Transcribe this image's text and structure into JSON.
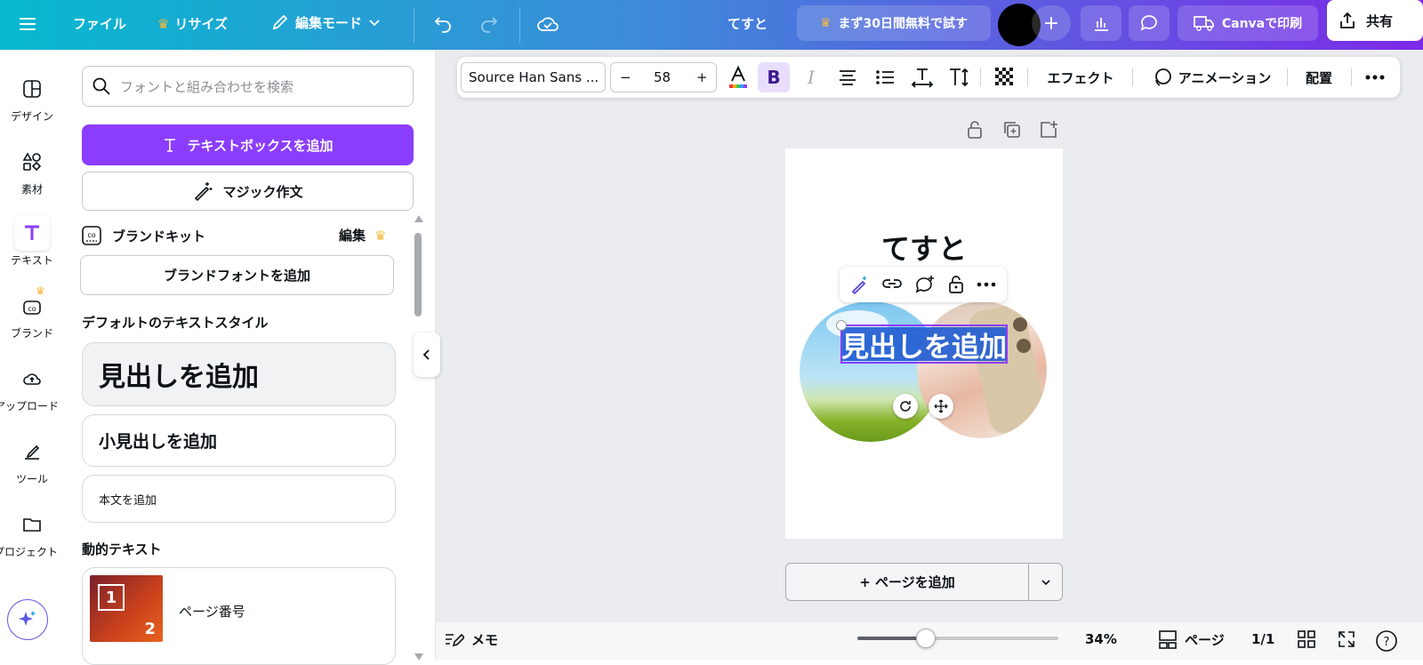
{
  "topbar": {
    "file_label": "ファイル",
    "resize_label": "リサイズ",
    "edit_mode_label": "編集モード",
    "doc_title": "てすと",
    "trial_label": "まず30日間無料で試す",
    "print_label": "Canvaで印刷",
    "share_label": "共有"
  },
  "rail": {
    "items": [
      {
        "label": "デザイン",
        "icon": "layout-icon"
      },
      {
        "label": "素材",
        "icon": "shapes-icon"
      },
      {
        "label": "テキスト",
        "icon": "text-icon"
      },
      {
        "label": "ブランド",
        "icon": "brand-icon"
      },
      {
        "label": "アップロード",
        "icon": "upload-icon"
      },
      {
        "label": "ツール",
        "icon": "draw-icon"
      },
      {
        "label": "プロジェクト",
        "icon": "folder-icon"
      }
    ]
  },
  "panel": {
    "search_placeholder": "フォントと組み合わせを検索",
    "add_textbox": "テキストボックスを追加",
    "magic_write": "マジック作文",
    "brand_kit": "ブランドキット",
    "edit": "編集",
    "add_brand_font": "ブランドフォントを追加",
    "default_styles_title": "デフォルトのテキストスタイル",
    "heading": "見出しを追加",
    "subheading": "小見出しを追加",
    "body": "本文を追加",
    "dynamic_title": "動的テキスト",
    "page_number": "ページ番号",
    "page_number_thumb_a": "1",
    "page_number_thumb_b": "2"
  },
  "toolbar": {
    "font": "Source Han Sans ...",
    "size_minus": "−",
    "size": "58",
    "size_plus": "+",
    "bold": "B",
    "italic": "I",
    "effects": "エフェクト",
    "animation": "アニメーション",
    "position": "配置"
  },
  "canvas": {
    "title_text": "てすと",
    "heading_text": "見出しを追加"
  },
  "add_page": "+ ページを追加",
  "bottom": {
    "notes": "メモ",
    "zoom": "34%",
    "zoom_level": 0.34,
    "pages_label": "ページ",
    "page_count": "1/1"
  },
  "colors": {
    "accent": "#8b3dff",
    "selection": "#1f5bd1"
  }
}
